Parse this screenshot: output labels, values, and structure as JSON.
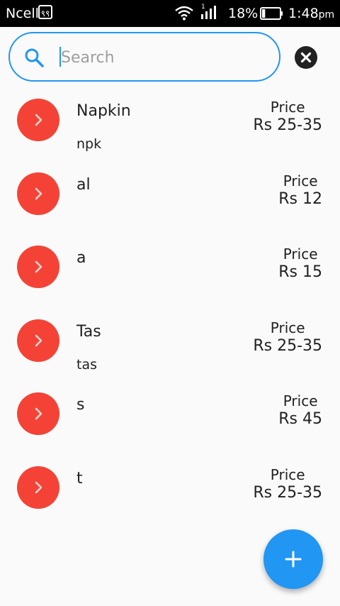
{
  "status_bar": {
    "carrier": "Ncell",
    "sim_badge": "९९",
    "signal_sim_number": "1",
    "battery_percent": "18%",
    "battery_level": 0.18,
    "time": "1:48",
    "time_suffix": "pm"
  },
  "search": {
    "placeholder": "Search",
    "value": ""
  },
  "items": [
    {
      "name": "Napkin",
      "code": "npk",
      "price_label": "Price",
      "price_value": "Rs 25-35"
    },
    {
      "name": "al",
      "code": "",
      "price_label": "Price",
      "price_value": "Rs 12"
    },
    {
      "name": "a",
      "code": "",
      "price_label": "Price",
      "price_value": "Rs 15"
    },
    {
      "name": "Tas",
      "code": "tas",
      "price_label": "Price",
      "price_value": "Rs 25-35"
    },
    {
      "name": "s",
      "code": "",
      "price_label": "Price",
      "price_value": "Rs 45"
    },
    {
      "name": "t",
      "code": "",
      "price_label": "Price",
      "price_value": "Rs 25-35"
    }
  ],
  "colors": {
    "accent": "#2196f3",
    "avatar": "#f44336",
    "status_bar": "#000000",
    "background": "#fafafa"
  },
  "icons": {
    "search": "search-icon",
    "clear": "close-icon",
    "avatar": "chevron-right-icon",
    "fab": "add-icon"
  }
}
